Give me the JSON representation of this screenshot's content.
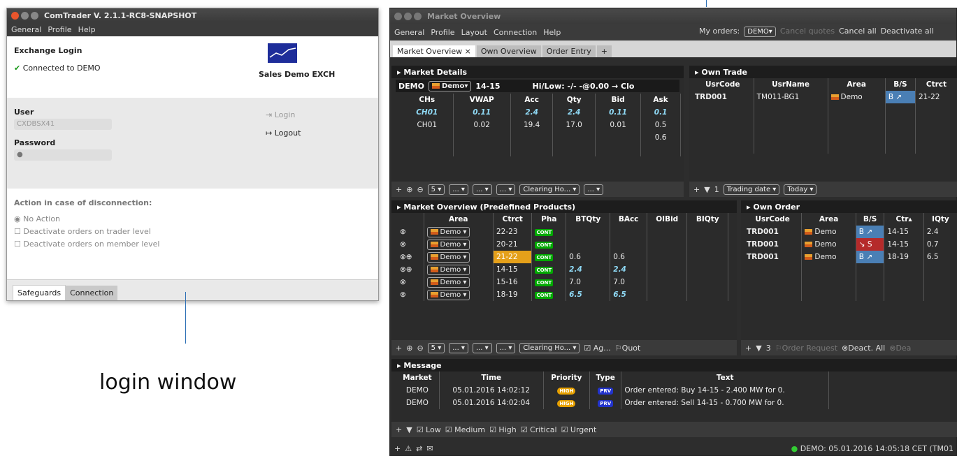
{
  "login": {
    "title": "ComTrader V. 2.1.1-RC8-SNAPSHOT",
    "menu": [
      "General",
      "Profile",
      "Help"
    ],
    "exchange_login": "Exchange Login",
    "connected": "Connected to DEMO",
    "exchange_name": "Sales Demo EXCH",
    "user_label": "User",
    "user_value": "CXDBSX41",
    "password_label": "Password",
    "password_value": "●",
    "login_btn": "Login",
    "logout_btn": "Logout",
    "disconnect_label": "Action in case of disconnection:",
    "options": [
      "No Action",
      "Deactivate orders on trader level",
      "Deactivate orders on member level"
    ],
    "tabs": [
      "Safeguards",
      "Connection"
    ]
  },
  "caption": "login window",
  "market": {
    "title": "Market Overview",
    "menu": [
      "General",
      "Profile",
      "Layout",
      "Connection",
      "Help"
    ],
    "my_orders_label": "My orders:",
    "my_orders_value": "DEMO▾",
    "cancel_quotes": "Cancel quotes",
    "cancel_all": "Cancel all",
    "deactivate_all": "Deactivate all",
    "tabs": [
      "Market Overview ×",
      "Own Overview",
      "Order Entry",
      "+"
    ],
    "details": {
      "title": "Market Details",
      "demo": "DEMO",
      "demo_select": "Demo▾",
      "contract": "14-15",
      "hilow": "Hi/Low: -/-  -@0.00 → Clo",
      "headers": [
        "CHs",
        "VWAP",
        "Acc",
        "Qty",
        "Bid",
        "Ask"
      ],
      "rows": [
        [
          "CH01",
          "0.11",
          "2.4",
          "2.4",
          "0.11",
          "0.1"
        ],
        [
          "CH01",
          "0.02",
          "19.4",
          "17.0",
          "0.01",
          "0.5"
        ],
        [
          "",
          "",
          "",
          "",
          "",
          "0.6"
        ]
      ],
      "toolbar": [
        "5 ▾",
        "... ▾",
        "... ▾",
        "... ▾",
        "Clearing Ho... ▾",
        "... ▾"
      ]
    },
    "own_trade": {
      "title": "Own Trade",
      "headers": [
        "UsrCode",
        "UsrName",
        "Area",
        "B/S",
        "Ctrct"
      ],
      "row": [
        "TRD001",
        "TM011-BG1",
        "Demo",
        "B ↗",
        "21-22"
      ],
      "toolbar_count": "1",
      "toolbar": [
        "Trading date ▾",
        "Today ▾"
      ]
    },
    "predef": {
      "title": "Market Overview (Predefined Products)",
      "headers": [
        "Area",
        "Ctrct",
        "Pha",
        "BTQty",
        "BAcc",
        "OIBid",
        "BIQty"
      ],
      "rows": [
        [
          "Demo ▾",
          "22-23",
          "CONT",
          "",
          "",
          "",
          ""
        ],
        [
          "Demo ▾",
          "20-21",
          "CONT",
          "",
          "",
          "",
          ""
        ],
        [
          "Demo ▾",
          "21-22",
          "CONT",
          "0.6",
          "0.6",
          "",
          ""
        ],
        [
          "Demo ▾",
          "14-15",
          "CONT",
          "2.4",
          "2.4",
          "",
          ""
        ],
        [
          "Demo ▾",
          "15-16",
          "CONT",
          "7.0",
          "7.0",
          "",
          ""
        ],
        [
          "Demo ▾",
          "18-19",
          "CONT",
          "6.5",
          "6.5",
          "",
          ""
        ]
      ],
      "toolbar": [
        "5 ▾",
        "... ▾",
        "... ▾",
        "... ▾",
        "Clearing Ho... ▾",
        "Ag...",
        "Quot"
      ]
    },
    "own_order": {
      "title": "Own Order",
      "headers": [
        "UsrCode",
        "Area",
        "B/S",
        "Ctr▴",
        "IQty"
      ],
      "rows": [
        [
          "TRD001",
          "Demo",
          "B ↗",
          "14-15",
          "2.4"
        ],
        [
          "TRD001",
          "Demo",
          "↘ S",
          "14-15",
          "0.7"
        ],
        [
          "TRD001",
          "Demo",
          "B ↗",
          "18-19",
          "6.5"
        ]
      ],
      "toolbar_count": "3",
      "order_request": "Order Request",
      "deact_all": "Deact. All",
      "dea": "Dea"
    },
    "message": {
      "title": "Message",
      "headers": [
        "Market",
        "Time",
        "Priority",
        "Type",
        "Text"
      ],
      "rows": [
        [
          "DEMO",
          "05.01.2016 14:02:12",
          "HIGH",
          "PRV",
          "Order entered: Buy 14-15 - 2.400 MW for 0."
        ],
        [
          "DEMO",
          "05.01.2016 14:02:04",
          "HIGH",
          "PRV",
          "Order entered: Sell 14-15 - 0.700 MW for 0."
        ]
      ],
      "filters": [
        "Low",
        "Medium",
        "High",
        "Critical",
        "Urgent"
      ]
    },
    "status": "DEMO: 05.01.2016 14:05:18 CET (TM01"
  }
}
